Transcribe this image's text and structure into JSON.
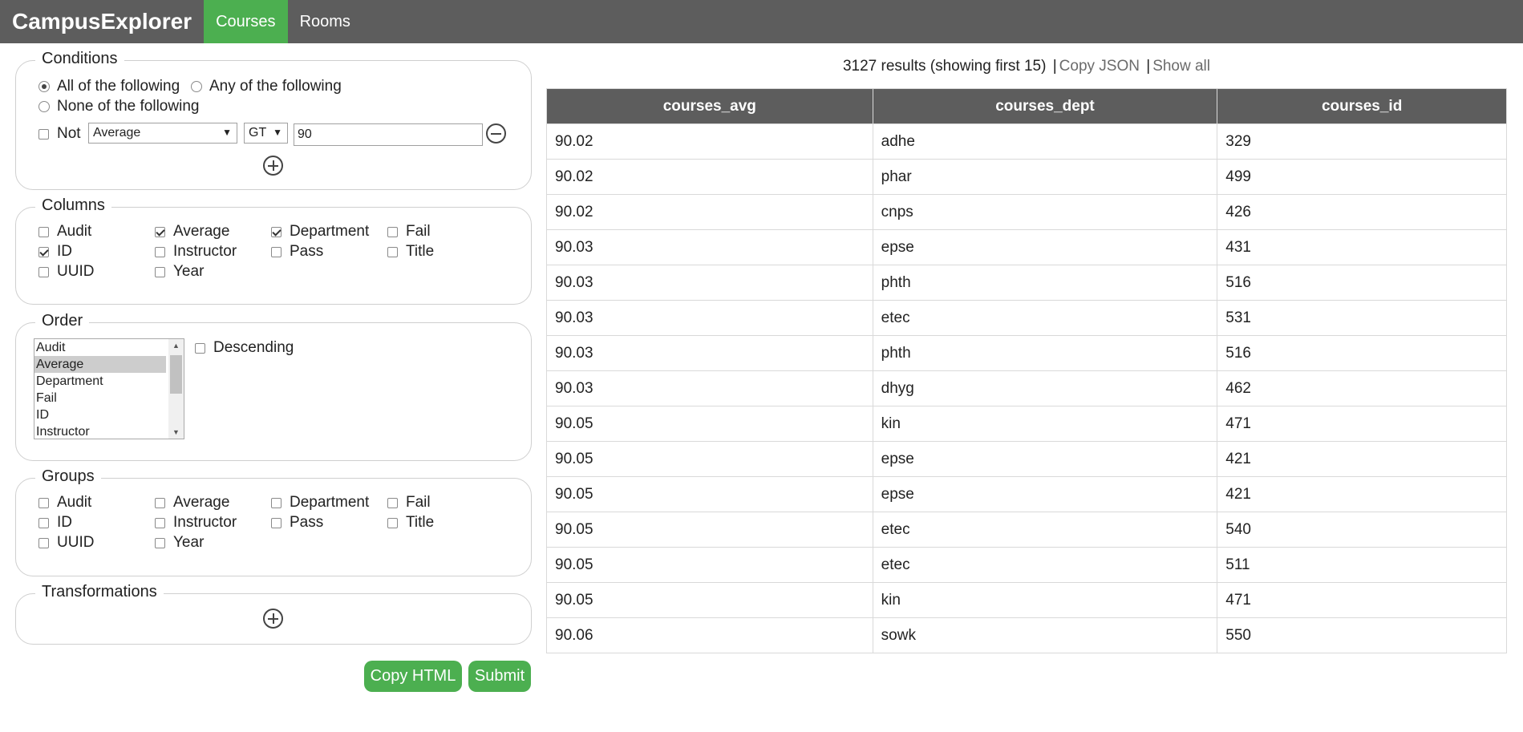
{
  "nav": {
    "brand": "CampusExplorer",
    "tabs": [
      {
        "label": "Courses",
        "active": true
      },
      {
        "label": "Rooms",
        "active": false
      }
    ]
  },
  "conditions": {
    "legend": "Conditions",
    "modes": [
      {
        "label": "All of the following",
        "checked": true
      },
      {
        "label": "Any of the following",
        "checked": false
      },
      {
        "label": "None of the following",
        "checked": false
      }
    ],
    "row": {
      "not_label": "Not",
      "not_checked": false,
      "field": "Average",
      "operator": "GT",
      "value": "90"
    }
  },
  "columns": {
    "legend": "Columns",
    "items": [
      {
        "label": "Audit",
        "checked": false
      },
      {
        "label": "Average",
        "checked": true
      },
      {
        "label": "Department",
        "checked": true
      },
      {
        "label": "Fail",
        "checked": false
      },
      {
        "label": "ID",
        "checked": true
      },
      {
        "label": "Instructor",
        "checked": false
      },
      {
        "label": "Pass",
        "checked": false
      },
      {
        "label": "Title",
        "checked": false
      },
      {
        "label": "UUID",
        "checked": false
      },
      {
        "label": "Year",
        "checked": false
      }
    ]
  },
  "order": {
    "legend": "Order",
    "options": [
      "Audit",
      "Average",
      "Department",
      "Fail",
      "ID",
      "Instructor"
    ],
    "selected_index": 1,
    "descending_label": "Descending",
    "descending_checked": false
  },
  "groups": {
    "legend": "Groups",
    "items": [
      {
        "label": "Audit",
        "checked": false
      },
      {
        "label": "Average",
        "checked": false
      },
      {
        "label": "Department",
        "checked": false
      },
      {
        "label": "Fail",
        "checked": false
      },
      {
        "label": "ID",
        "checked": false
      },
      {
        "label": "Instructor",
        "checked": false
      },
      {
        "label": "Pass",
        "checked": false
      },
      {
        "label": "Title",
        "checked": false
      },
      {
        "label": "UUID",
        "checked": false
      },
      {
        "label": "Year",
        "checked": false
      }
    ]
  },
  "transformations": {
    "legend": "Transformations"
  },
  "buttons": {
    "copy_html": "Copy HTML",
    "submit": "Submit"
  },
  "results": {
    "summary": "3127 results (showing first 15)",
    "copy_json": "Copy JSON",
    "show_all": "Show all",
    "separator": "|",
    "headers": [
      "courses_avg",
      "courses_dept",
      "courses_id"
    ],
    "rows": [
      [
        "90.02",
        "adhe",
        "329"
      ],
      [
        "90.02",
        "phar",
        "499"
      ],
      [
        "90.02",
        "cnps",
        "426"
      ],
      [
        "90.03",
        "epse",
        "431"
      ],
      [
        "90.03",
        "phth",
        "516"
      ],
      [
        "90.03",
        "etec",
        "531"
      ],
      [
        "90.03",
        "phth",
        "516"
      ],
      [
        "90.03",
        "dhyg",
        "462"
      ],
      [
        "90.05",
        "kin",
        "471"
      ],
      [
        "90.05",
        "epse",
        "421"
      ],
      [
        "90.05",
        "epse",
        "421"
      ],
      [
        "90.05",
        "etec",
        "540"
      ],
      [
        "90.05",
        "etec",
        "511"
      ],
      [
        "90.05",
        "kin",
        "471"
      ],
      [
        "90.06",
        "sowk",
        "550"
      ]
    ]
  }
}
